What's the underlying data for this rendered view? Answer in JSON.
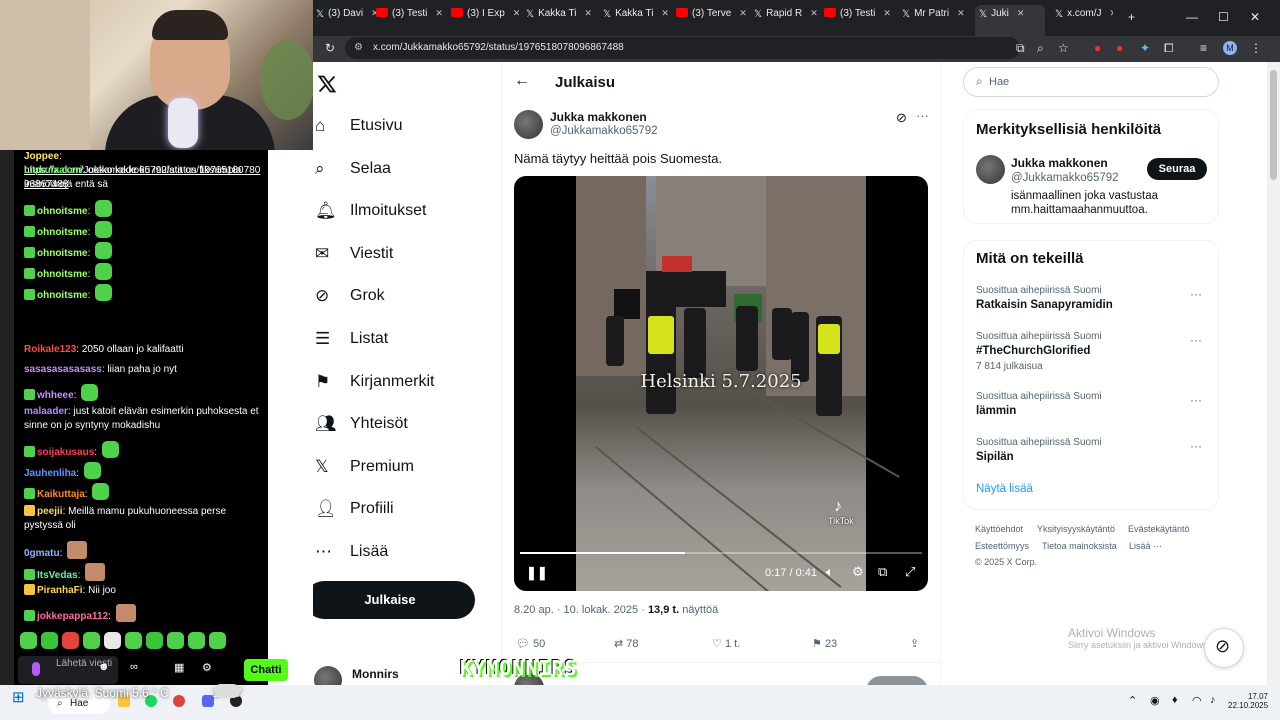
{
  "browser": {
    "tabs": [
      {
        "label": "(3) Davi",
        "icon": "x-logo-icon"
      },
      {
        "label": "(3) Testi",
        "icon": "youtube-icon"
      },
      {
        "label": "(3) I Exp",
        "icon": "youtube-icon"
      },
      {
        "label": "Kakka Ti",
        "icon": "x-logo-icon"
      },
      {
        "label": "Kakka Ti",
        "icon": "x-logo-icon"
      },
      {
        "label": "(3) Terve",
        "icon": "youtube-icon"
      },
      {
        "label": "Rapid R",
        "icon": "x-logo-icon"
      },
      {
        "label": "(3) Testi",
        "icon": "youtube-icon"
      },
      {
        "label": "Mr Patri",
        "icon": "x-logo-icon"
      },
      {
        "label": "Juki",
        "icon": "x-logo-icon"
      },
      {
        "label": "x.com/J",
        "icon": "x-logo-icon"
      }
    ],
    "url": "x.com/Jukkamakko65792/status/1976518078096867488"
  },
  "stream": {
    "chat": [
      {
        "user": "Joppee",
        "text": "https://x.com/Jukkamakko65792/status/1976518078096867488",
        "color": "#ffe66b"
      },
      {
        "user": "Liukulaakeri",
        "text": "ootko kade ku mulatit on fiksumpia insinöörejä entä sä",
        "color": "#6cf26c"
      },
      {
        "user": "ohnoitsme",
        "text": "",
        "color": "#a0ff6b"
      },
      {
        "user": "ohnoitsme",
        "text": "",
        "color": "#a0ff6b"
      },
      {
        "user": "ohnoitsme",
        "text": "",
        "color": "#a0ff6b"
      },
      {
        "user": "ohnoitsme",
        "text": "",
        "color": "#a0ff6b"
      },
      {
        "user": "ohnoitsme",
        "text": "",
        "color": "#a0ff6b"
      },
      {
        "user": "Roikale123",
        "text": "2050 ollaan jo kalifaatti",
        "color": "#ff4d4d"
      },
      {
        "user": "sasasasasasass",
        "text": "liian paha jo nyt",
        "color": "#c88bff"
      },
      {
        "user": "whheee",
        "text": "",
        "color": "#c88bff"
      },
      {
        "user": "malaader",
        "text": "just katoit elävän esimerkin puhoksesta et sinne on jo syntyny mokadishu",
        "color": "#b58bff"
      },
      {
        "user": "soijakusaus",
        "text": "",
        "color": "#ff3b5c"
      },
      {
        "user": "Jauhenliha",
        "text": "",
        "color": "#5b9bff"
      },
      {
        "user": "Kaikuttaja",
        "text": "",
        "color": "#ff8a2a"
      },
      {
        "user": "peejii",
        "text": "Meillä mamu pukuhuoneessa perse pystyssä oli",
        "color": "#ffd84d"
      },
      {
        "user": "0gmatu",
        "text": "",
        "color": "#8ab4ff"
      },
      {
        "user": "ItsVedas",
        "text": "",
        "color": "#6cf2a0"
      },
      {
        "user": "PiranhaFi",
        "text": "Nii joo",
        "color": "#ffd84d"
      },
      {
        "user": "jokkepappa112",
        "text": "",
        "color": "#ff6b9b"
      }
    ],
    "chat_placeholder": "Lähetä viesti",
    "chat_button": "Chatti",
    "overlay_name": "KYMONNIRS",
    "weather": "Jyväskylä, Suomi   5.6 ° C",
    "weather_time": "17.07"
  },
  "x": {
    "nav": [
      {
        "label": "Etusivu",
        "icon": "home-icon"
      },
      {
        "label": "Selaa",
        "icon": "search-icon"
      },
      {
        "label": "Ilmoitukset",
        "icon": "bell-icon"
      },
      {
        "label": "Viestit",
        "icon": "mail-icon"
      },
      {
        "label": "Grok",
        "icon": "grok-icon"
      },
      {
        "label": "Listat",
        "icon": "list-icon"
      },
      {
        "label": "Kirjanmerkit",
        "icon": "bookmark-icon"
      },
      {
        "label": "Yhteisöt",
        "icon": "communities-icon"
      },
      {
        "label": "Premium",
        "icon": "x-logo-icon"
      },
      {
        "label": "Profiili",
        "icon": "profile-icon"
      },
      {
        "label": "Lisää",
        "icon": "more-icon"
      }
    ],
    "post_button": "Julkaise",
    "account_name": "Monnirs",
    "header_title": "Julkaisu",
    "post": {
      "author_name": "Jukka makkonen",
      "author_handle": "@Jukkamakko65792",
      "text": "Nämä täytyy heittää pois Suomesta.",
      "video_caption": "Helsinki 5.7.2025",
      "video_watermark": "TikTok",
      "video_time": "0:17 / 0:41",
      "video_progress": 0.41,
      "meta_time": "8.20 ap. · 10. lokak. 2025 ·",
      "views_count": "13,9 t.",
      "views_label": "näyttöä",
      "replies": "50",
      "reposts": "78",
      "likes": "1 t.",
      "bookmarks": "23"
    },
    "search_placeholder": "Hae",
    "relevant": {
      "title": "Merkityksellisiä henkilöitä",
      "name": "Jukka makkonen",
      "handle": "@Jukkamakko65792",
      "bio": "isänmaallinen joka vastustaa mm.haittamaahanmuuttoa.",
      "follow": "Seuraa"
    },
    "trending": {
      "title": "Mitä on tekeillä",
      "items": [
        {
          "category": "Suosittua aihepiirissä Suomi",
          "name": "Ratkaisin Sanapyramidin",
          "count": ""
        },
        {
          "category": "Suosittua aihepiirissä Suomi",
          "name": "#TheChurchGlorified",
          "count": "7 814 julkaisua"
        },
        {
          "category": "Suosittua aihepiirissä Suomi",
          "name": "lämmin",
          "count": ""
        },
        {
          "category": "Suosittua aihepiirissä Suomi",
          "name": "Sipilän",
          "count": ""
        }
      ],
      "show_more": "Näytä lisää"
    },
    "footer": [
      "Käyttöehdot",
      "Yksityisyyskäytäntö",
      "Evästekäytäntö",
      "Esteettömyys",
      "Tietoa mainoksista",
      "Lisää ···",
      "© 2025 X Corp."
    ],
    "activate_title": "Aktivoi Windows",
    "activate_sub": "Siirry asetuksiin ja aktivoi Windows."
  },
  "taskbar": {
    "search": "Hae",
    "time": "17.07",
    "date": "22.10.2025"
  },
  "colors": {
    "accent": "#1d9bf0",
    "kick_green": "#53fc18",
    "text": "#0f1419",
    "muted": "#536471"
  }
}
